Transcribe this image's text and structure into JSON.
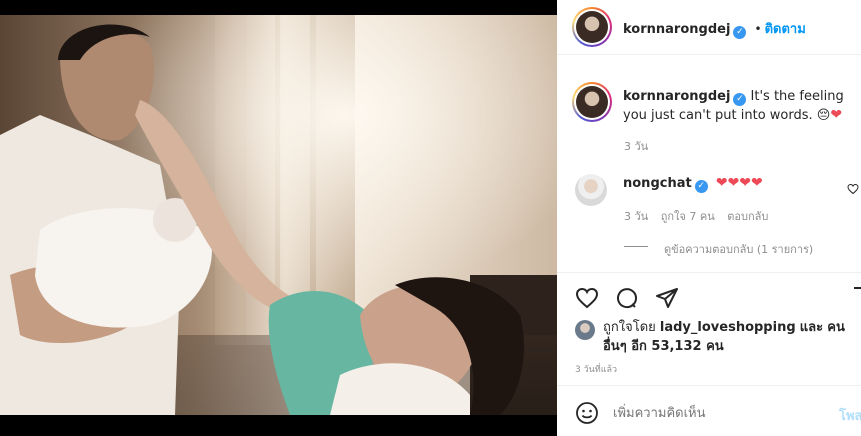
{
  "post": {
    "image_alt": "Father holding newborn, mother reaching from hospital bed"
  },
  "header": {
    "username": "kornnarongdej",
    "separator": "•",
    "follow_label": "ติดตาม"
  },
  "caption": {
    "username": "kornnarongdej",
    "text": "It's the feeling you just can't put into words.",
    "emoji_1": "😔",
    "emoji_2": "❤",
    "time": "3 วัน"
  },
  "comment": {
    "username": "nongchat",
    "hearts": "❤❤❤❤",
    "time": "3 วัน",
    "likes": "ถูกใจ 7 คน",
    "reply_label": "ตอบกลับ",
    "view_replies": "ดูข้อความตอบกลับ (1 รายการ)"
  },
  "likes": {
    "prefix": "ถูกใจโดย",
    "user": "lady_loveshopping",
    "and": "และ",
    "others": "คนอื่นๆ อีก 53,132 คน"
  },
  "timestamp": "3 วันที่แล้ว",
  "add_comment": {
    "placeholder": "เพิ่มความคิดเห็น",
    "post_label": "โพสต์"
  },
  "colors": {
    "accent": "#0095f6",
    "heart": "#ed4956",
    "text": "#262626",
    "muted": "#8e8e8e"
  }
}
